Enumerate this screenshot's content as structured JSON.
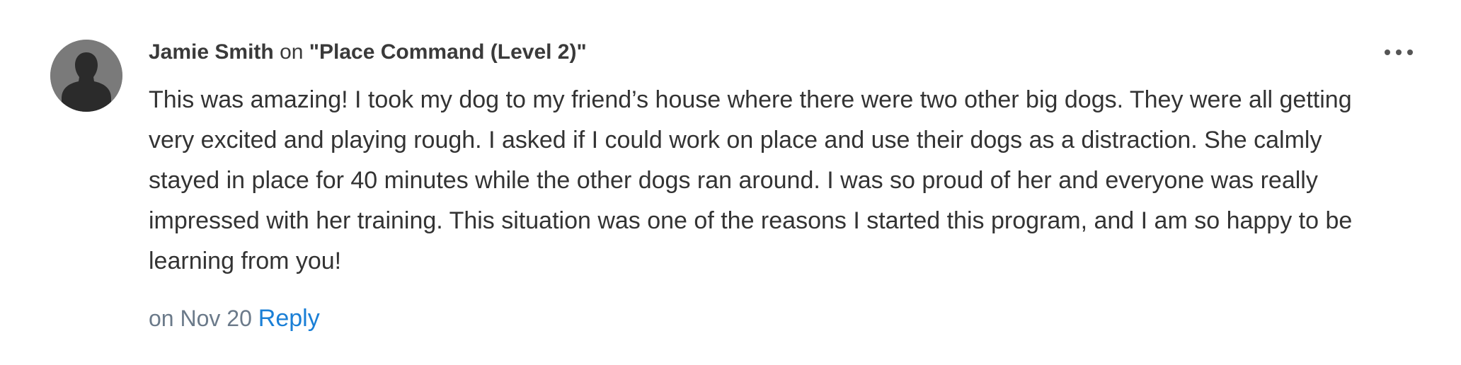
{
  "comment": {
    "author": "Jamie Smith",
    "on_word": "on",
    "lesson_title": "\"Place Command (Level 2)\"",
    "text": "This was amazing! I took my dog to my friend’s house where there were two other big dogs. They were all getting very excited and playing rough. I asked if I could work on place and use their dogs as a distraction. She calmly stayed in place for 40 minutes while the other dogs ran around. I was so proud of her and everyone was really impressed with her training. This situation was one of the reasons I started this program, and I am so happy to be learning from you!",
    "date": "on Nov 20",
    "reply_label": "Reply",
    "avatar_icon": "default-user-silhouette-icon",
    "menu_icon": "more-horizontal-icon"
  },
  "colors": {
    "avatar_bg": "#7a7a7a",
    "silhouette": "#2b2b2b",
    "text": "#333333",
    "date": "#6b7a8a",
    "link": "#1a7fd6"
  }
}
